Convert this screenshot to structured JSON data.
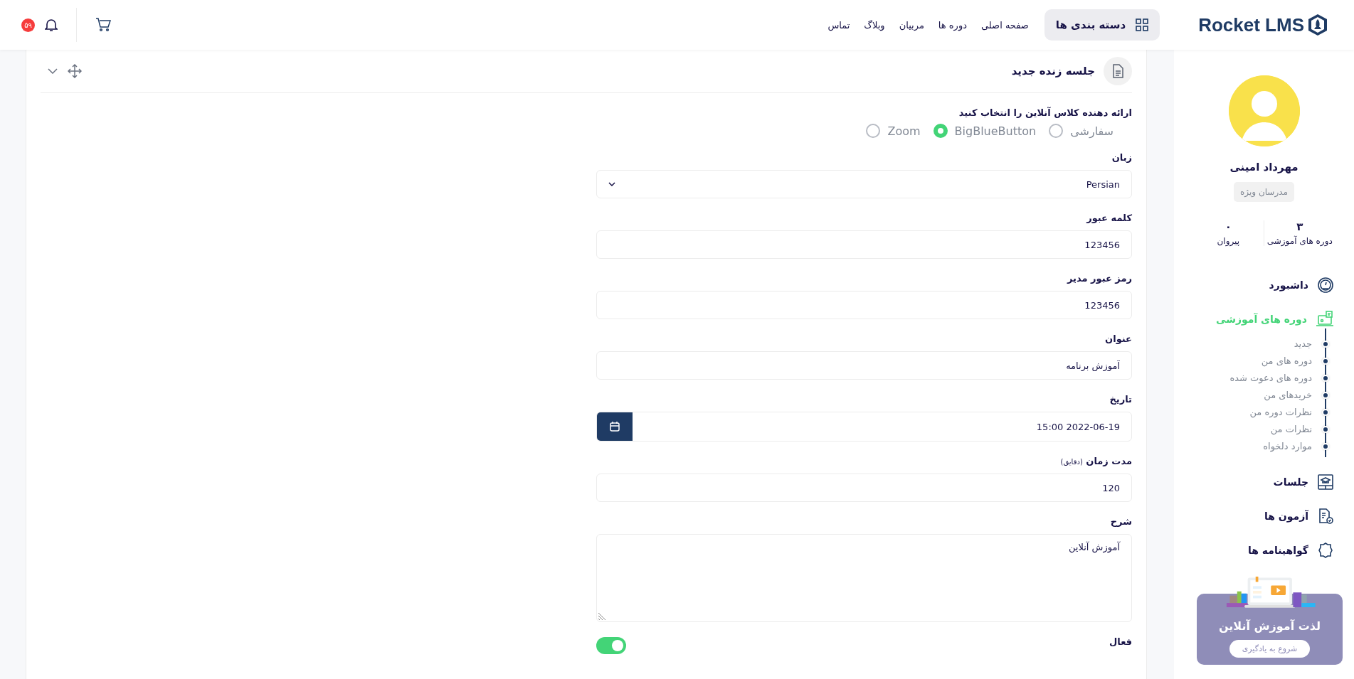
{
  "header": {
    "logo": "Rocket LMS",
    "categories_button": "دسته بندی ها",
    "nav": [
      "صفحه اصلی",
      "دوره ها",
      "مربیان",
      "وبلاگ",
      "تماس"
    ],
    "notification_count": "۵۹"
  },
  "profile": {
    "name": "مهرداد امینی",
    "badge": "مدرسان ویژه",
    "stats": [
      {
        "value": "۳",
        "label": "دوره های آموزشی"
      },
      {
        "value": "۰",
        "label": "پیروان"
      }
    ]
  },
  "menu": [
    {
      "label": "داشبورد",
      "kind": "dashboard",
      "selected": false
    },
    {
      "label": "دوره های آموزشی",
      "kind": "courses",
      "selected": true,
      "children": [
        {
          "label": "جدید"
        },
        {
          "label": "دوره های من"
        },
        {
          "label": "دوره های دعوت شده"
        },
        {
          "label": "خریدهای من"
        },
        {
          "label": "نظرات دوره من"
        },
        {
          "label": "نظرات من"
        },
        {
          "label": "موارد دلخواه"
        }
      ]
    },
    {
      "label": "جلسات",
      "kind": "meetings",
      "selected": false
    },
    {
      "label": "آزمون ها",
      "kind": "quizzes",
      "selected": false
    },
    {
      "label": "گواهینامه ها",
      "kind": "certificates",
      "selected": false
    }
  ],
  "promo": {
    "title": "لذت آموزش آنلاین",
    "button": "شروع به یادگیری"
  },
  "card": {
    "title": "جلسه زنده جدید",
    "provider": {
      "label": "ارائه دهنده کلاس آنلاین را انتخاب کنید",
      "options": [
        {
          "label": "سفارشی",
          "selected": false
        },
        {
          "label": "BigBlueButton",
          "selected": true
        },
        {
          "label": "Zoom",
          "selected": false
        }
      ]
    },
    "fields": [
      {
        "kind": "select",
        "label": "زبان",
        "value": "Persian"
      },
      {
        "kind": "text",
        "label": "کلمه عبور",
        "value": "123456"
      },
      {
        "kind": "text",
        "label": "رمز عبور مدیر",
        "value": "123456"
      },
      {
        "kind": "text",
        "label": "عنوان",
        "value": "آموزش برنامه"
      },
      {
        "kind": "date",
        "label": "تاریخ",
        "value": "15:00 2022-06-19"
      },
      {
        "kind": "text",
        "label": "مدت زمان",
        "note": "(دقایق)",
        "value": "120"
      },
      {
        "kind": "textarea",
        "label": "شرح",
        "value": "آموزش آنلاین"
      }
    ],
    "active": {
      "label": "فعال",
      "on": true
    }
  }
}
